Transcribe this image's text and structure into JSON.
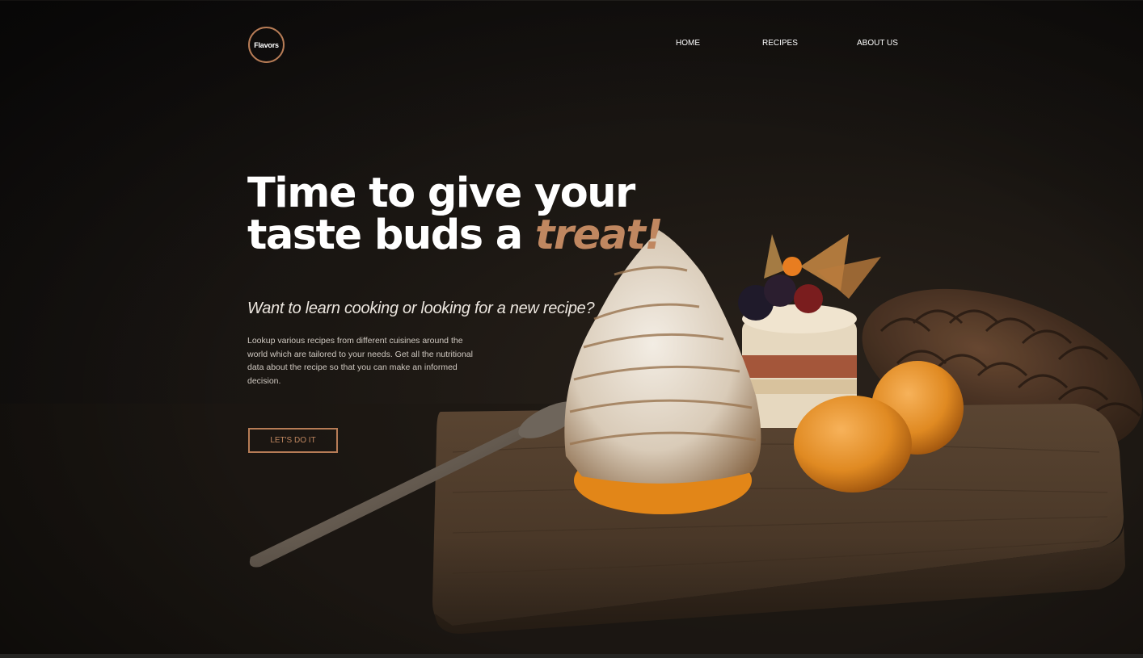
{
  "header": {
    "logo_text": "Flavors",
    "nav": [
      {
        "label": "HOME"
      },
      {
        "label": "RECIPES"
      },
      {
        "label": "ABOUT US"
      }
    ]
  },
  "hero": {
    "headline_part1": "Time to give your taste buds a ",
    "headline_accent": "treat!",
    "subheadline": "Want to learn cooking or looking for a new recipe?",
    "description": "Lookup various recipes from different cuisines around the world which are tailored to your needs. Get all the nutritional data about the recipe so that you can make an informed decision.",
    "cta_label": "LET'S DO IT"
  },
  "colors": {
    "background": "#14120f",
    "accent": "#c08760",
    "accent_border": "#b77c56",
    "text": "#ffffff"
  },
  "images": {
    "hero_photo": "meringue-dessert-on-wooden-board"
  }
}
